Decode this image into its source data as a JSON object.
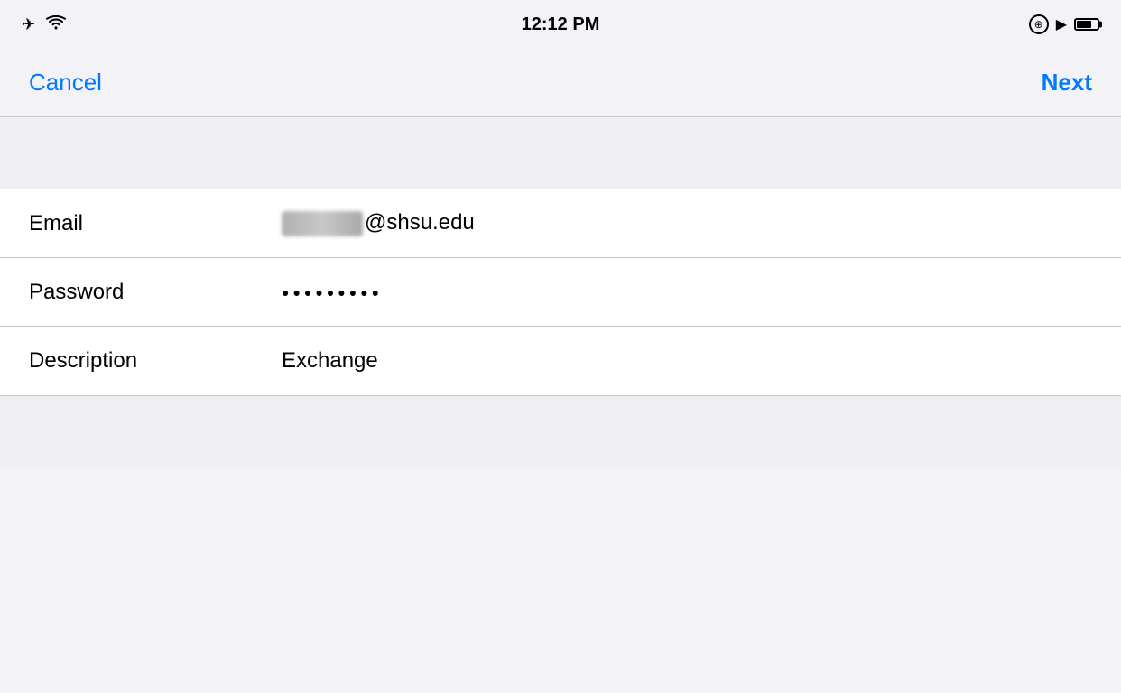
{
  "statusBar": {
    "time": "12:12 PM",
    "airplaneMode": true,
    "wifi": true,
    "lockIcon": "⊕",
    "locationIcon": "◁"
  },
  "navBar": {
    "cancelLabel": "Cancel",
    "nextLabel": "Next"
  },
  "form": {
    "emailLabel": "Email",
    "emailDomain": "@shsu.edu",
    "passwordLabel": "Password",
    "passwordDots": "●●●●●●●●●",
    "descriptionLabel": "Description",
    "descriptionValue": "Exchange"
  }
}
